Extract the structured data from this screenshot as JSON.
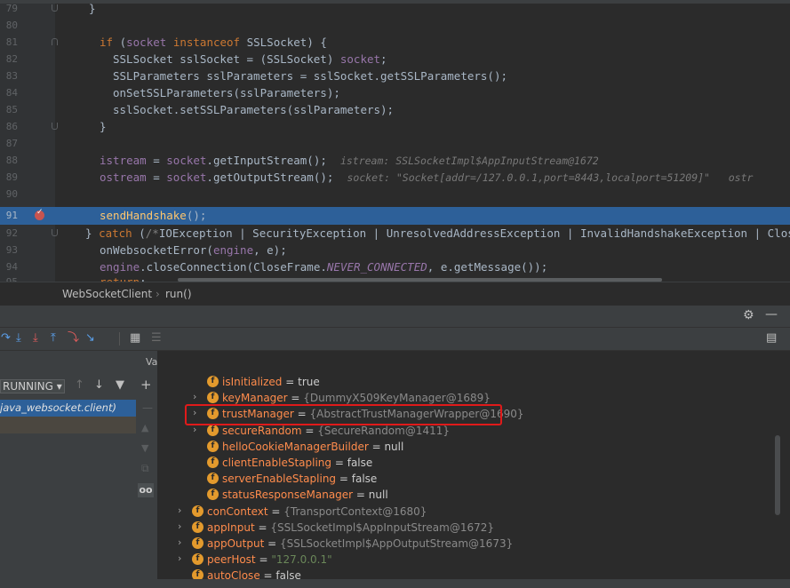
{
  "editor": {
    "lines": [
      {
        "num": "79",
        "text": "  }"
      },
      {
        "num": "80",
        "text": ""
      },
      {
        "num": "81",
        "text": "  if (socket instanceof SSLSocket) {"
      },
      {
        "num": "82",
        "text": "    SSLSocket sslSocket = (SSLSocket) socket;"
      },
      {
        "num": "83",
        "text": "    SSLParameters sslParameters = sslSocket.getSSLParameters();"
      },
      {
        "num": "84",
        "text": "    onSetSSLParameters(sslParameters);"
      },
      {
        "num": "85",
        "text": "    sslSocket.setSSLParameters(sslParameters);"
      },
      {
        "num": "86",
        "text": "  }"
      },
      {
        "num": "87",
        "text": ""
      },
      {
        "num": "88",
        "text": "  istream = socket.getInputStream();",
        "inline": "istream: SSLSocketImpl$AppInputStream@1672"
      },
      {
        "num": "89",
        "text": "  ostream = socket.getOutputStream();",
        "inline": "socket: \"Socket[addr=/127.0.0.1,port=8443,localport=51209]\"   ostr"
      },
      {
        "num": "90",
        "text": ""
      },
      {
        "num": "91",
        "text": "  sendHandshake();"
      },
      {
        "num": "92",
        "text": "} catch (/*IOException | SecurityException | UnresolvedAddressException | InvalidHandshakeException | Clos"
      },
      {
        "num": "93",
        "text": "  onWebsocketError(engine, e);"
      },
      {
        "num": "94",
        "text": "  engine.closeConnection(CloseFrame.NEVER_CONNECTED, e.getMessage());"
      },
      {
        "num": "95",
        "text": "  return;"
      }
    ]
  },
  "breadcrumb": {
    "class_name": "WebSocketClient",
    "separator": "›",
    "method": "run()"
  },
  "frames": {
    "thread_state": "RUNNING ▾",
    "frame_label": "java_websocket.client)"
  },
  "variables_title": "Variables",
  "variables": [
    {
      "arrow": "",
      "icon": "f",
      "name": "isInitialized",
      "eq": " = ",
      "value": "true",
      "kind": "val"
    },
    {
      "arrow": "›",
      "icon": "f",
      "name": "keyManager",
      "eq": " = ",
      "value": "{DummyX509KeyManager@1689}",
      "kind": "ref"
    },
    {
      "arrow": "›",
      "icon": "f",
      "name": "trustManager",
      "eq": " = ",
      "value": "{AbstractTrustManagerWrapper@1690}",
      "kind": "ref"
    },
    {
      "arrow": "›",
      "icon": "f",
      "name": "secureRandom",
      "eq": " = ",
      "value": "{SecureRandom@1411}",
      "kind": "ref"
    },
    {
      "arrow": "",
      "icon": "f",
      "name": "helloCookieManagerBuilder",
      "eq": " = ",
      "value": "null",
      "kind": "val"
    },
    {
      "arrow": "",
      "icon": "f",
      "name": "clientEnableStapling",
      "eq": " = ",
      "value": "false",
      "kind": "val"
    },
    {
      "arrow": "",
      "icon": "f",
      "name": "serverEnableStapling",
      "eq": " = ",
      "value": "false",
      "kind": "val"
    },
    {
      "arrow": "",
      "icon": "f",
      "name": "statusResponseManager",
      "eq": " = ",
      "value": "null",
      "kind": "val"
    },
    {
      "arrow": "›",
      "icon": "f",
      "name": "conContext",
      "eq": " = ",
      "value": "{TransportContext@1680}",
      "kind": "ref"
    },
    {
      "arrow": "›",
      "icon": "f",
      "name": "appInput",
      "eq": " = ",
      "value": "{SSLSocketImpl$AppInputStream@1672}",
      "kind": "ref"
    },
    {
      "arrow": "›",
      "icon": "f",
      "name": "appOutput",
      "eq": " = ",
      "value": "{SSLSocketImpl$AppOutputStream@1673}",
      "kind": "ref"
    },
    {
      "arrow": "›",
      "icon": "f",
      "name": "peerHost",
      "eq": " = ",
      "value": "\"127.0.0.1\"",
      "kind": "str"
    },
    {
      "arrow": "",
      "icon": "f",
      "name": "autoClose",
      "eq": " = ",
      "value": "false",
      "kind": "val"
    }
  ],
  "colors": {
    "accent_highlight": "#2d6099",
    "annotation_box": "#e01a1a",
    "field_icon": "#e39a2d"
  },
  "icons": [
    "gear-icon",
    "minimize-icon",
    "step-over-icon",
    "step-into-icon",
    "force-step-into-icon",
    "step-out-icon",
    "drop-frame-icon",
    "run-to-cursor-icon",
    "evaluate-icon",
    "layout-icon",
    "filter-icon",
    "add-watch-icon",
    "breakpoint-icon",
    "watches-glasses-icon"
  ]
}
